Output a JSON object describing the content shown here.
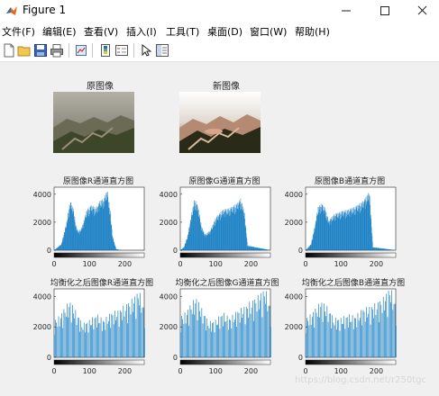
{
  "window": {
    "title": "Figure 1",
    "controls": [
      "minimize-icon",
      "maximize-icon",
      "close-icon"
    ]
  },
  "menu": {
    "items": [
      {
        "label": "文件(F)"
      },
      {
        "label": "编辑(E)"
      },
      {
        "label": "查看(V)"
      },
      {
        "label": "插入(I)"
      },
      {
        "label": "工具(T)"
      },
      {
        "label": "桌面(D)"
      },
      {
        "label": "窗口(W)"
      },
      {
        "label": "帮助(H)"
      }
    ]
  },
  "toolbar": {
    "icons": [
      "new-figure-icon",
      "open-file-icon",
      "save-icon",
      "print-icon",
      "link-plot-icon",
      "insert-colorbar-icon",
      "insert-legend-icon",
      "edit-plot-arrow-icon",
      "property-inspector-icon"
    ]
  },
  "images": {
    "original_title": "原图像",
    "new_title": "新图像"
  },
  "histograms": {
    "titles": {
      "orig_r": "原图像R通道直方图",
      "orig_g": "原图像G通道直方图",
      "orig_b": "原图像B通道直方图",
      "eq_r": "均衡化之后图像R通道直方图",
      "eq_g": "均衡化之后图像G通道直方图",
      "eq_b": "均衡化之后图像B通道直方图"
    },
    "yticks": [
      "4000",
      "2000",
      "0"
    ],
    "xticks": [
      "0",
      "100",
      "200"
    ]
  },
  "chart_data": [
    {
      "type": "bar",
      "title": "原图像R通道直方图",
      "x": [
        0,
        20,
        35,
        45,
        55,
        62,
        70,
        80,
        92,
        105,
        118,
        130,
        140,
        150,
        158,
        165,
        175,
        190,
        255
      ],
      "y": [
        0,
        400,
        1800,
        3200,
        2600,
        1500,
        1200,
        1600,
        2600,
        2900,
        2700,
        3200,
        3300,
        3900,
        2600,
        900,
        80,
        0,
        0
      ],
      "xlim": [
        0,
        255
      ],
      "ylim": [
        0,
        4500
      ]
    },
    {
      "type": "bar",
      "title": "原图像G通道直方图",
      "x": [
        0,
        10,
        20,
        30,
        40,
        50,
        60,
        70,
        85,
        100,
        120,
        140,
        160,
        170,
        180,
        190,
        255
      ],
      "y": [
        0,
        200,
        900,
        2200,
        3300,
        2800,
        1500,
        1000,
        1300,
        2100,
        2600,
        2700,
        3000,
        3300,
        2600,
        300,
        0
      ],
      "xlim": [
        0,
        255
      ],
      "ylim": [
        0,
        4500
      ]
    },
    {
      "type": "bar",
      "title": "原图像B通道直方图",
      "x": [
        0,
        15,
        25,
        35,
        45,
        55,
        65,
        80,
        100,
        120,
        140,
        160,
        170,
        180,
        190,
        255
      ],
      "y": [
        0,
        400,
        1500,
        2800,
        3000,
        2700,
        1900,
        2300,
        2500,
        2600,
        2800,
        3100,
        3400,
        3800,
        200,
        0
      ],
      "xlim": [
        0,
        255
      ],
      "ylim": [
        0,
        4500
      ]
    },
    {
      "type": "bar",
      "title": "均衡化之后图像R通道直方图",
      "x": [
        0,
        15,
        30,
        45,
        60,
        80,
        100,
        120,
        140,
        160,
        180,
        200,
        220,
        240,
        255
      ],
      "y": [
        2000,
        2200,
        2700,
        3000,
        2500,
        1800,
        2000,
        2300,
        2000,
        2400,
        2500,
        2800,
        3100,
        3600,
        2500
      ],
      "xlim": [
        0,
        255
      ],
      "ylim": [
        0,
        4500
      ]
    },
    {
      "type": "bar",
      "title": "均衡化之后图像G通道直方图",
      "x": [
        0,
        15,
        30,
        45,
        60,
        80,
        100,
        120,
        140,
        160,
        180,
        200,
        220,
        240,
        255
      ],
      "y": [
        2200,
        2400,
        2900,
        3200,
        2600,
        1900,
        2000,
        2400,
        2100,
        2500,
        2700,
        3000,
        3300,
        3700,
        2600
      ],
      "xlim": [
        0,
        255
      ],
      "ylim": [
        0,
        4500
      ]
    },
    {
      "type": "bar",
      "title": "均衡化之后图像B通道直方图",
      "x": [
        0,
        15,
        30,
        45,
        60,
        80,
        100,
        120,
        140,
        160,
        180,
        200,
        220,
        240,
        255
      ],
      "y": [
        2100,
        2300,
        2700,
        3000,
        2700,
        2100,
        2100,
        2300,
        2200,
        2600,
        2700,
        2900,
        3200,
        3800,
        2700
      ],
      "xlim": [
        0,
        255
      ],
      "ylim": [
        0,
        4500
      ]
    }
  ],
  "watermark": "https://blog.csdn.net/r250tgc"
}
